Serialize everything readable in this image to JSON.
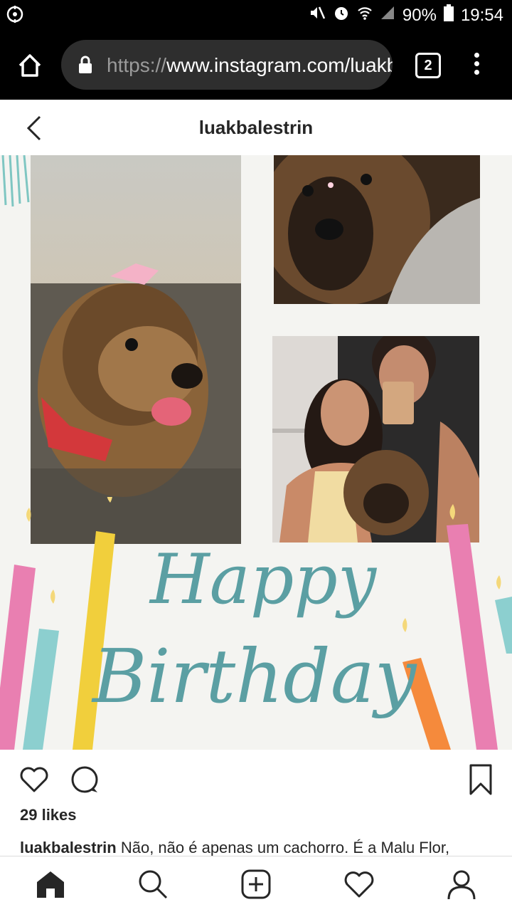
{
  "status_bar": {
    "battery": "90%",
    "time": "19:54"
  },
  "browser": {
    "url_scheme": "https://",
    "url_rest": "www.instagram.com/luakbalestrin",
    "tab_count": "2"
  },
  "header": {
    "title": "luakbalestrin"
  },
  "post": {
    "image_text_line1": "Happy",
    "image_text_line2": "Birthday",
    "likes": "29 likes",
    "caption_user": "luakbalestrin",
    "caption_text": " Não, não é apenas um cachorro. É a Malu Flor,"
  },
  "colors": {
    "card_teal": "#5b9fa3",
    "candle_pink": "#e97fb1",
    "candle_yellow": "#f1cf3c",
    "candle_teal": "#8ccfcf",
    "candle_orange": "#f58a3c"
  }
}
